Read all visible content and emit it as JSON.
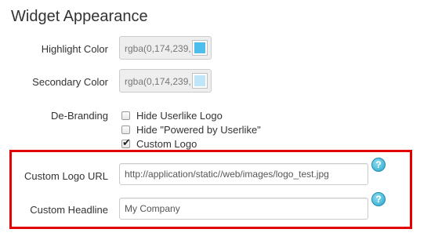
{
  "section": {
    "title": "Widget Appearance"
  },
  "highlight_color": {
    "label": "Highlight Color",
    "value": "rgba(0,174,239,",
    "swatch_color": "#4dbdeb"
  },
  "secondary_color": {
    "label": "Secondary Color",
    "value": "rgba(0,174,239,",
    "swatch_color": "#bfe6f7"
  },
  "debranding": {
    "label": "De-Branding",
    "options": [
      {
        "label": "Hide Userlike Logo",
        "checked": false
      },
      {
        "label": "Hide \"Powered by Userlike\"",
        "checked": false
      },
      {
        "label": "Custom Logo",
        "checked": true
      }
    ]
  },
  "custom_logo_url": {
    "label": "Custom Logo URL",
    "value": "http://application/static//web/images/logo_test.jpg",
    "help_icon": "question-icon"
  },
  "custom_headline": {
    "label": "Custom Headline",
    "value": "My Company",
    "help_icon": "question-icon"
  },
  "colors": {
    "highlight_border": "#e30000",
    "help_icon": "#2aa6cc"
  }
}
